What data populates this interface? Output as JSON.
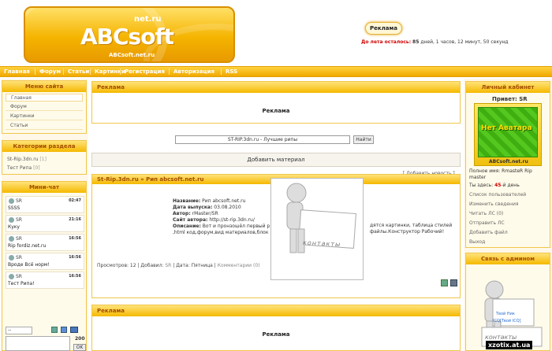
{
  "header": {
    "logo_small": "net.ru",
    "logo_main": "ABCsoft",
    "logo_url": "ABCsoft.net.ru",
    "ad_label": "Реклама",
    "countdown_prefix": "До лета осталось:",
    "countdown_days": "85",
    "countdown_text": "дней, 1 часов, 12 минут, 50 секунд"
  },
  "nav": [
    "Главная",
    "Форум",
    "Статьи",
    "Картинки",
    "Регистрация",
    "Авторизация",
    "RSS"
  ],
  "menu": {
    "title": "Меню сайта",
    "items": [
      "Главная",
      "Форум",
      "Картинки",
      "Статьи"
    ]
  },
  "categories": {
    "title": "Категории раздела",
    "items": [
      {
        "name": "St-Rip.3dn.ru",
        "count": "[1]"
      },
      {
        "name": "Тест Рипа",
        "count": "[0]"
      }
    ]
  },
  "chat": {
    "title": "Мини-чат",
    "messages": [
      {
        "user": "SR",
        "time": "02:47",
        "text": "SSSS"
      },
      {
        "user": "SR",
        "time": "21:16",
        "text": "Куку"
      },
      {
        "user": "SR",
        "time": "16:56",
        "text": "Rip fordiz.net.ru"
      },
      {
        "user": "SR",
        "time": "16:56",
        "text": "Вроде Всё норм!"
      },
      {
        "user": "SR",
        "time": "16:56",
        "text": "Тест Рипа!"
      }
    ],
    "select_value": "--",
    "count": "200",
    "ok_label": "OK"
  },
  "ad_block": {
    "title": "Реклама",
    "text": "Реклама"
  },
  "search": {
    "value": "ST-RIP.3dn.ru - Лучшие рипы",
    "button": "Найти"
  },
  "add_material": "Добавить материал",
  "add_news": "[ Добавить новость ]",
  "article": {
    "title": "St-Rip.3dn.ru » Рип abcsoft.net.ru",
    "fields": [
      {
        "label": "Название:",
        "value": "Рип abcsoft.net.ru"
      },
      {
        "label": "Дата выпуска:",
        "value": "03.08.2010"
      },
      {
        "label": "Автор:",
        "value": "rMaster/SR"
      },
      {
        "label": "Сайт автора:",
        "value": "http://st-rip.3dn.ru/"
      },
      {
        "label": "Описание:",
        "value": "Вот и пронзошёл первый р"
      }
    ],
    "desc_cont1": "дятся картинки, таблица стилей",
    "desc_line2": ",html код,форум,вид материалов,блок",
    "desc_cont2": "файлы.Конструктор Рабочий!",
    "footer_views": "Просмотров: 12",
    "footer_added_by": "Добавил:",
    "footer_user": "SR",
    "footer_date": "Дата: Пятница",
    "footer_comments": "Комментарии (0)"
  },
  "overlay": {
    "sign": "контакты",
    "sign2": "контакты"
  },
  "cabinet": {
    "title": "Личный кабинет",
    "greeting": "Привет: SR",
    "avatar_text": "Нет Аватара",
    "avatar_url": "ABCsoft.net.ru",
    "full_name": "Полное имя: RmasteR Rip master",
    "days_prefix": "Ты здесь:",
    "days": "45",
    "days_suffix": "-й день",
    "links": [
      "Список пользователей",
      "Изменить сведения",
      "Читать ЛС (0)",
      "Отправить ЛС",
      "Добавить файл",
      "Выход"
    ]
  },
  "contact": {
    "title": "Связь с админом",
    "icq1": "Твой Ник",
    "icq2": "ICQ[Твой ICQ]"
  },
  "watermark": "xzotix.at.ua",
  "colors": {
    "accent": "#f5b800",
    "header_text": "#a34d00"
  }
}
